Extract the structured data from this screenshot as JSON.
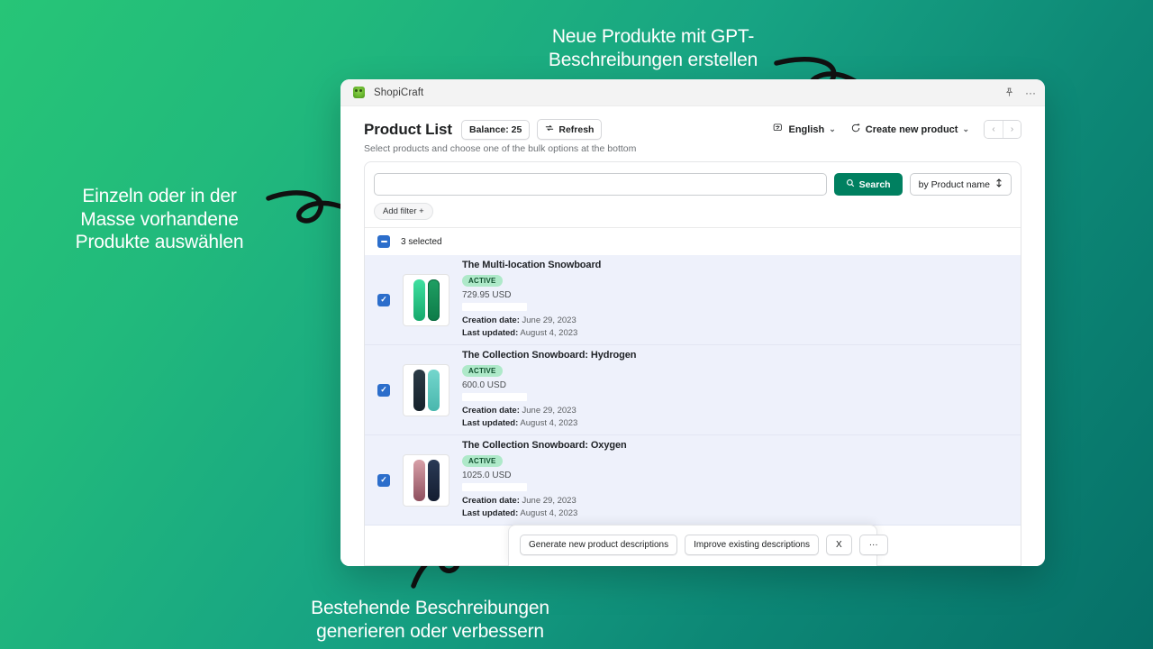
{
  "annotations": {
    "top": "Neue Produkte mit GPT-\nBeschreibungen erstellen",
    "left": "Einzeln oder in der\nMasse vorhandene\nProdukte auswählen",
    "bottom": "Bestehende Beschreibungen\ngenerieren oder verbessern"
  },
  "window": {
    "app_name": "ShopiCraft",
    "pin_icon": "pin-icon",
    "more_icon": "more-options-icon"
  },
  "header": {
    "title": "Product List",
    "balance_label": "Balance: 25",
    "refresh_label": "Refresh",
    "refresh_icon": "refresh-icon",
    "subtitle": "Select products and choose one of the bulk options at the bottom",
    "language_label": "English",
    "language_icon": "translate-icon",
    "create_label": "Create new product",
    "create_icon": "sparkle-icon",
    "chevron": "⌄",
    "pager_prev": "‹",
    "pager_next": "›"
  },
  "search": {
    "value": "",
    "placeholder": "",
    "search_button": "Search",
    "search_icon": "search-icon",
    "sort_label": "by Product name",
    "sort_icon": "sort-icon",
    "add_filter": "Add filter  +"
  },
  "selection": {
    "checkbox_state": "indeterminate",
    "count_label": "3 selected"
  },
  "products": [
    {
      "name": "The Multi-location Snowboard",
      "status": "ACTIVE",
      "price": "729.95 USD",
      "creation_label": "Creation date:",
      "creation_date": "June 29, 2023",
      "updated_label": "Last updated:",
      "updated_date": "August 4, 2023",
      "checked": true,
      "thumb_colors": [
        "#2ecc8f",
        "#1f9f63"
      ]
    },
    {
      "name": "The Collection Snowboard: Hydrogen",
      "status": "ACTIVE",
      "price": "600.0 USD",
      "creation_label": "Creation date:",
      "creation_date": "June 29, 2023",
      "updated_label": "Last updated:",
      "updated_date": "August 4, 2023",
      "checked": true,
      "thumb_colors": [
        "#1d2a33",
        "#5fc9c0"
      ]
    },
    {
      "name": "The Collection Snowboard: Oxygen",
      "status": "ACTIVE",
      "price": "1025.0 USD",
      "creation_label": "Creation date:",
      "creation_date": "June 29, 2023",
      "updated_label": "Last updated:",
      "updated_date": "August 4, 2023",
      "checked": true,
      "thumb_colors": [
        "#b06a7a",
        "#1b2740"
      ]
    }
  ],
  "bulk_bar": {
    "generate_label": "Generate new product descriptions",
    "improve_label": "Improve existing descriptions",
    "close_label": "X",
    "more_label": "···"
  },
  "colors": {
    "brand_green": "#008060",
    "bg_top_left": "#27c577",
    "bg_bottom_right": "#067068",
    "checkbox_blue": "#2c6ecb",
    "row_bg": "#eef1fb",
    "badge_bg": "#aee9c9"
  }
}
